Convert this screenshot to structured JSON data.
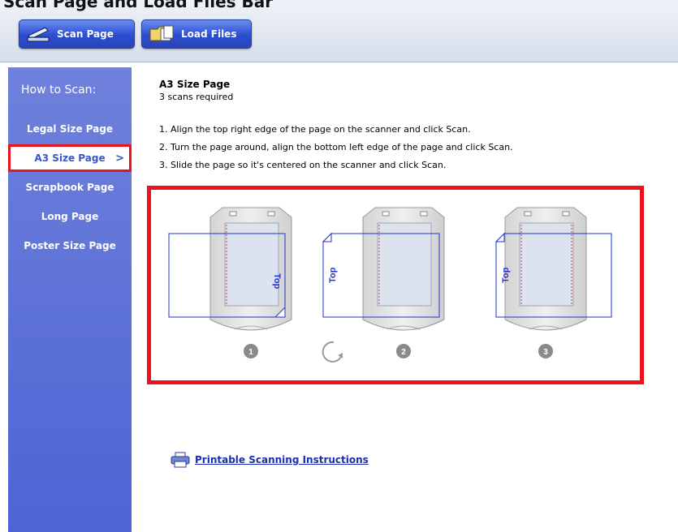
{
  "toolbar": {
    "caption": "Scan Page and Load Files Bar",
    "scan_label": "Scan Page",
    "load_label": "Load Files"
  },
  "sidebar": {
    "heading": "How to Scan:",
    "items": [
      {
        "label": "Legal Size Page"
      },
      {
        "label": "A3 Size Page",
        "active": true
      },
      {
        "label": "Scrapbook Page"
      },
      {
        "label": "Long Page"
      },
      {
        "label": "Poster Size Page"
      }
    ]
  },
  "main": {
    "title": "A3 Size Page",
    "subtitle": "3 scans required",
    "steps": [
      "1. Align the top right edge of the page on the scanner and click Scan.",
      "2. Turn the page around, align the bottom left edge of the page and click Scan.",
      "3. Slide the page so it's centered on the scanner and click Scan."
    ],
    "diagram": {
      "page_label": "Top",
      "step_numbers": [
        "1",
        "2",
        "3"
      ]
    },
    "print_link": "Printable Scanning Instructions"
  },
  "colors": {
    "sidebar": "#5c70d8",
    "highlight": "#e8131b",
    "link": "#1a2fb0"
  }
}
